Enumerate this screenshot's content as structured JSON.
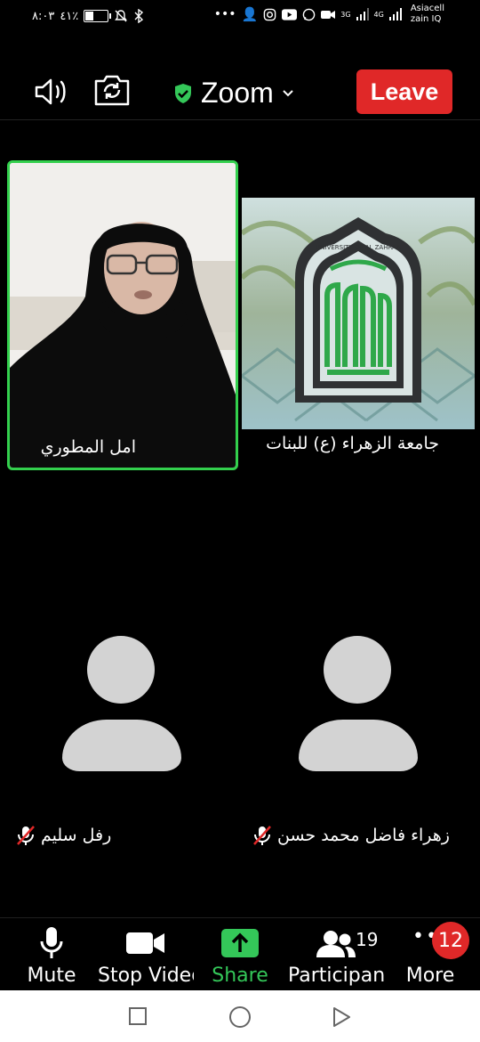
{
  "status_bar": {
    "time": "٨:٠٣",
    "battery": "٤١٪",
    "carrier_line1": "Asiacell",
    "carrier_line2": "zain IQ",
    "net1": "3G",
    "net2": "4G"
  },
  "top_bar": {
    "app_title": "Zoom",
    "leave_label": "Leave"
  },
  "participants_tiles": [
    {
      "name": "امل المطوري",
      "active_speaker": true
    },
    {
      "name": "جامعة الزهراء (ع) للبنات",
      "active_speaker": false
    },
    {
      "name": "رفل سليم",
      "muted": true
    },
    {
      "name": "زهراء فاضل محمد حسن",
      "muted": true
    }
  ],
  "logo": {
    "ring_text": "UNIVERSITY OF AL ZAHRAA"
  },
  "toolbar": {
    "mute_label": "Mute",
    "video_label": "Stop Video",
    "share_label": "Share",
    "participants_label": "Participants",
    "participants_count": "19",
    "more_label": "More",
    "more_badge": "12"
  },
  "colors": {
    "leave": "#e02828",
    "active_border": "#33d04d",
    "share": "#34c759"
  }
}
